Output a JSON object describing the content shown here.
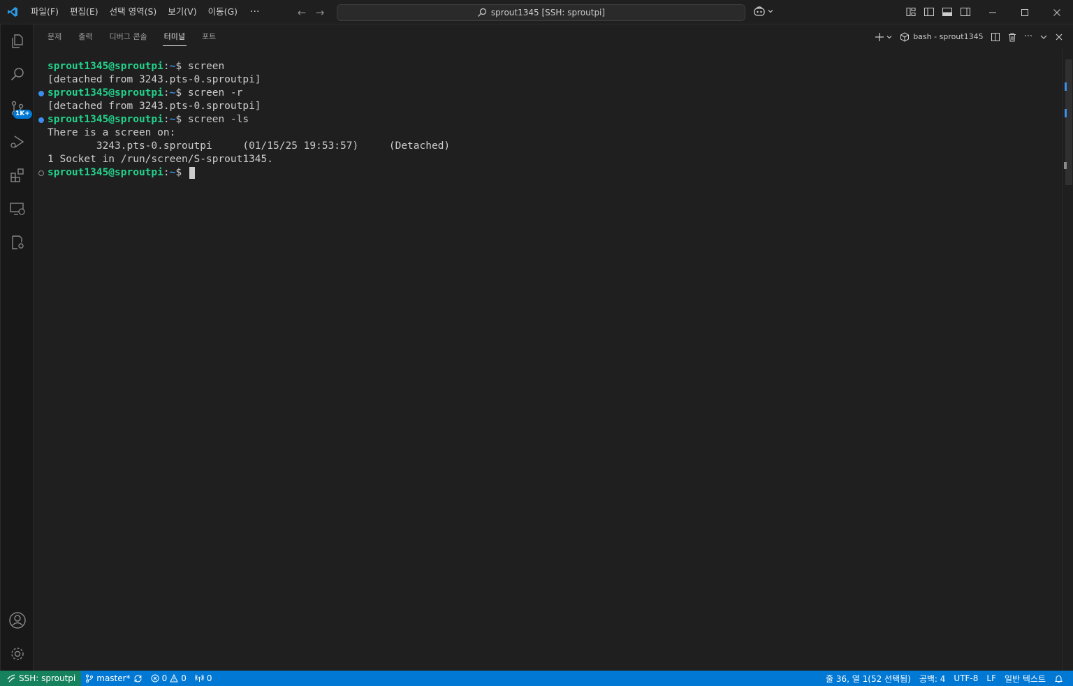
{
  "titlebar": {
    "menus": [
      "파일(F)",
      "편집(E)",
      "선택 영역(S)",
      "보기(V)",
      "이동(G)"
    ],
    "more": "···",
    "command_center": "sprout1345 [SSH: sproutpi]"
  },
  "activitybar": {
    "source_control_badge": "1K+"
  },
  "panel": {
    "tabs": [
      "문제",
      "출력",
      "디버그 콘솔",
      "터미널",
      "포트"
    ],
    "active_tab": "터미널",
    "terminal_name": "bash - sprout1345"
  },
  "terminal": {
    "prompt_user": "sprout1345@sproutpi",
    "prompt_path": "~",
    "lines": [
      {
        "type": "prompt",
        "cmd": "screen",
        "deco": "none"
      },
      {
        "type": "output",
        "text": "[detached from 3243.pts-0.sproutpi]"
      },
      {
        "type": "prompt",
        "cmd": "screen -r",
        "deco": "filled"
      },
      {
        "type": "output",
        "text": "[detached from 3243.pts-0.sproutpi]"
      },
      {
        "type": "prompt",
        "cmd": "screen -ls",
        "deco": "filled"
      },
      {
        "type": "output",
        "text": "There is a screen on:"
      },
      {
        "type": "output",
        "text": "        3243.pts-0.sproutpi     (01/15/25 19:53:57)     (Detached)"
      },
      {
        "type": "output",
        "text": "1 Socket in /run/screen/S-sprout1345."
      },
      {
        "type": "prompt",
        "cmd": "",
        "deco": "hollow",
        "cursor": true
      }
    ]
  },
  "statusbar": {
    "remote": "SSH: sproutpi",
    "branch": "master*",
    "errors": "0",
    "warnings": "0",
    "ports": "0",
    "cursor_position": "줄 36, 열 1(52 선택됨)",
    "indent": "공백: 4",
    "encoding": "UTF-8",
    "eol": "LF",
    "language": "일반 텍스트"
  },
  "colors": {
    "accent": "#0078d4",
    "remote": "#16825d",
    "prompt_user": "#23d18b",
    "prompt_path": "#3b8eea",
    "background": "#1f1f1f"
  }
}
